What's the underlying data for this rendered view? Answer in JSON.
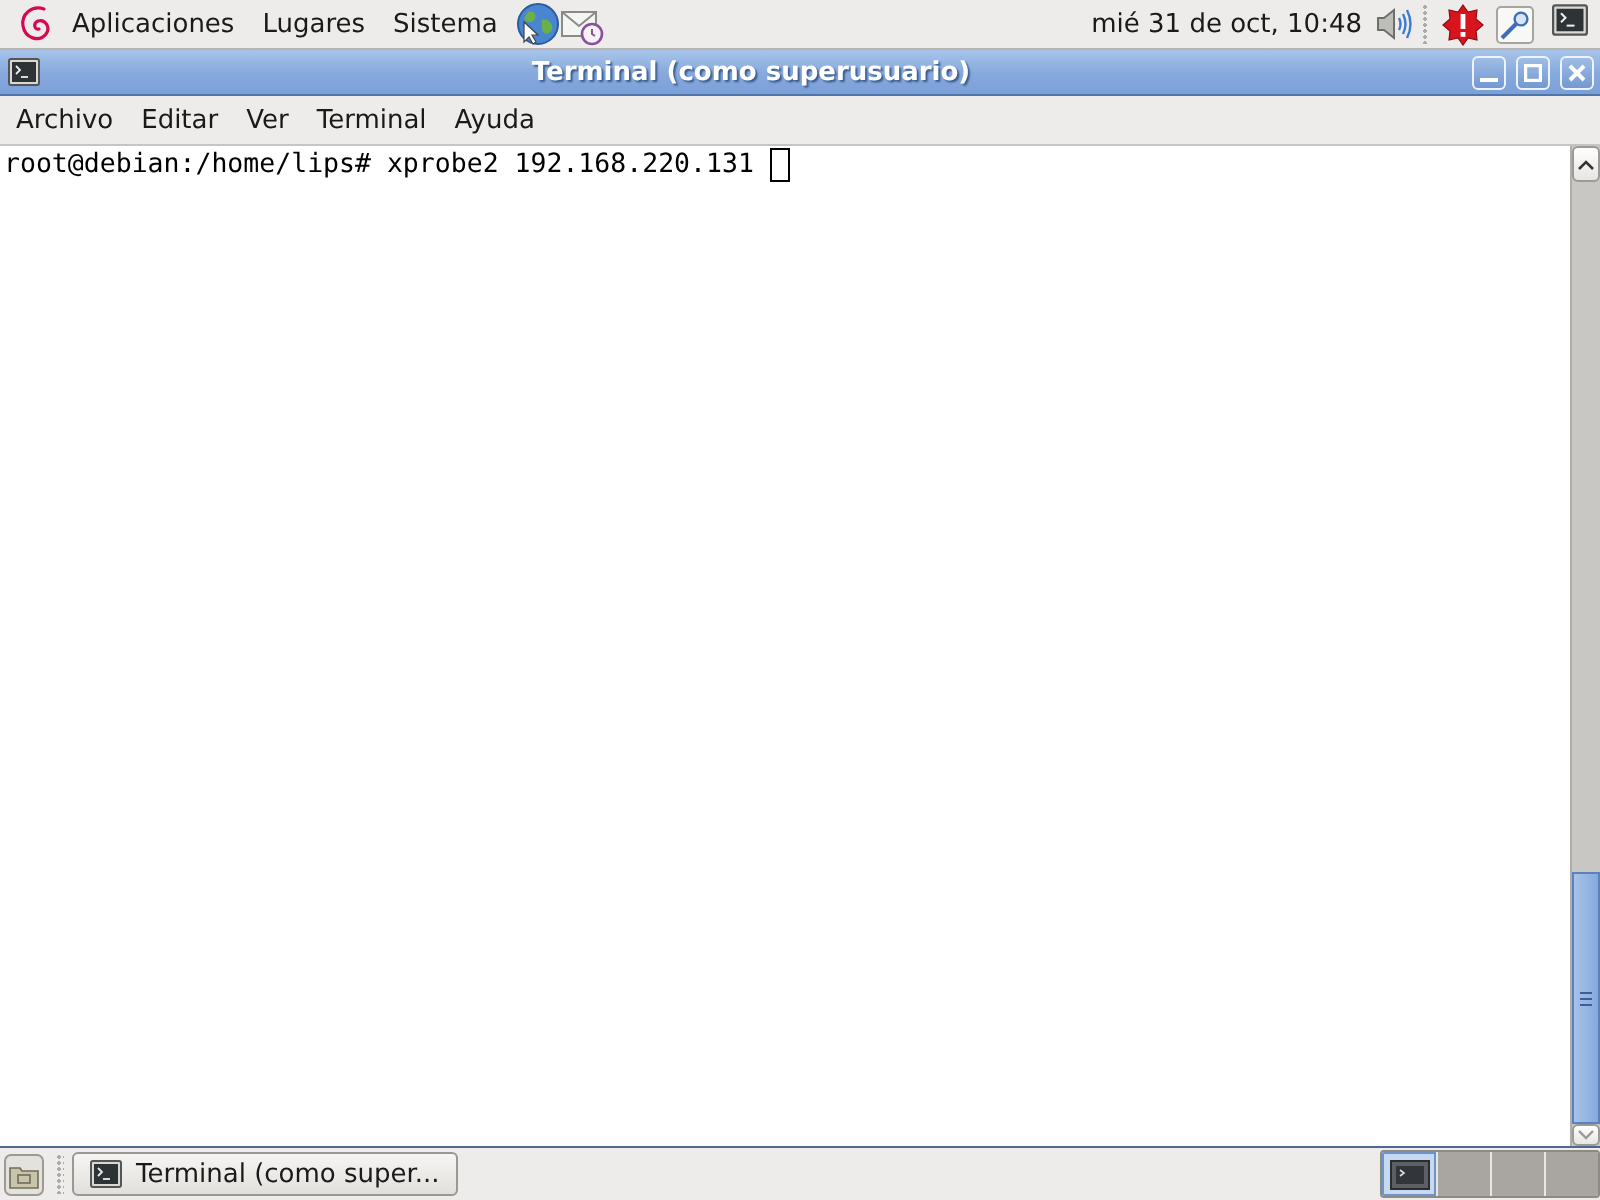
{
  "top_panel": {
    "menus": [
      "Aplicaciones",
      "Lugares",
      "Sistema"
    ],
    "clock": "mié 31 de oct, 10:48"
  },
  "window": {
    "title": "Terminal (como superusuario)"
  },
  "menu_bar": [
    "Archivo",
    "Editar",
    "Ver",
    "Terminal",
    "Ayuda"
  ],
  "terminal": {
    "lines": [
      "root@debian:/home/lips# xprobe2 192.168.220.131"
    ]
  },
  "bottom_panel": {
    "tasks": [
      {
        "label": "Terminal (como super..."
      }
    ],
    "workspaces": [
      {
        "selected": true,
        "has_window": true
      },
      {
        "selected": false,
        "has_window": false
      },
      {
        "selected": false,
        "has_window": false
      },
      {
        "selected": false,
        "has_window": false
      }
    ]
  }
}
